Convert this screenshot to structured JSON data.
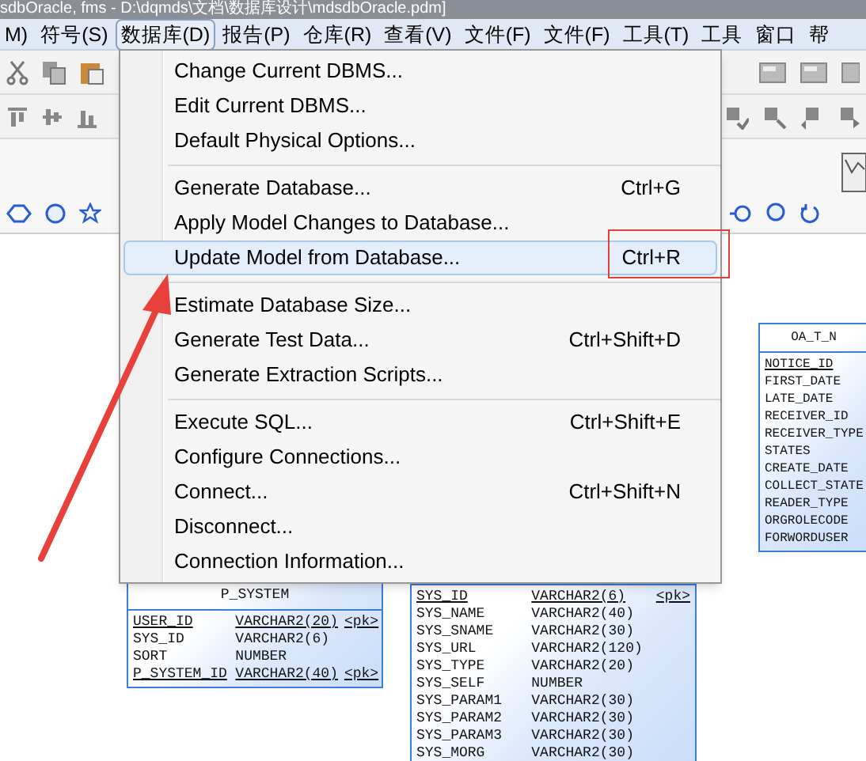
{
  "window": {
    "title": "sdbOracle, fms - D:\\dqmds\\文档\\数据库设计\\mdsdbOracle.pdm]"
  },
  "menu_bar": [
    {
      "label": "M)",
      "selected": false
    },
    {
      "label": "符号(S)",
      "selected": false
    },
    {
      "label": "数据库(D)",
      "selected": true
    },
    {
      "label": "报告(P)",
      "selected": false
    },
    {
      "label": "仓库(R)",
      "selected": false
    },
    {
      "label": "查看(V)",
      "selected": false
    },
    {
      "label": "文件(F)",
      "selected": false
    },
    {
      "label": "文件(F)",
      "selected": false
    },
    {
      "label": "工具(T)",
      "selected": false
    },
    {
      "label": "工具",
      "selected": false
    },
    {
      "label": "窗口",
      "selected": false
    },
    {
      "label": "帮",
      "selected": false
    }
  ],
  "dropdown": {
    "groups": [
      [
        {
          "label": "Change Current DBMS...",
          "selected": false
        },
        {
          "label": "Edit Current DBMS...",
          "selected": false
        },
        {
          "label": "Default Physical Options...",
          "selected": false
        }
      ],
      [
        {
          "label": "Generate Database...",
          "shortcut": "Ctrl+G",
          "selected": false
        },
        {
          "label": "Apply Model Changes to Database...",
          "selected": false
        },
        {
          "label": "Update Model from Database...",
          "shortcut": "Ctrl+R",
          "selected": true
        }
      ],
      [
        {
          "label": "Estimate Database Size...",
          "selected": false
        },
        {
          "label": "Generate Test Data...",
          "shortcut": "Ctrl+Shift+D",
          "selected": false
        },
        {
          "label": "Generate Extraction Scripts...",
          "selected": false
        }
      ],
      [
        {
          "label": "Execute SQL...",
          "shortcut": "Ctrl+Shift+E",
          "selected": false
        },
        {
          "label": "Configure Connections...",
          "selected": false
        },
        {
          "label": "Connect...",
          "shortcut": "Ctrl+Shift+N",
          "selected": false
        },
        {
          "label": "Disconnect...",
          "selected": false
        },
        {
          "label": "Connection Information...",
          "selected": false
        }
      ]
    ]
  },
  "diagram": {
    "tables": [
      {
        "name": "P_SYSTEM",
        "columns": [
          {
            "name": "USER_ID",
            "type": "VARCHAR2(20)",
            "key": "<pk>"
          },
          {
            "name": "SYS_ID",
            "type": "VARCHAR2(6)"
          },
          {
            "name": "SORT",
            "type": "NUMBER"
          },
          {
            "name": "P_SYSTEM_ID",
            "type": "VARCHAR2(40)",
            "key": "<pk>"
          }
        ]
      },
      {
        "columns": [
          {
            "name": "SYS_ID",
            "type": "VARCHAR2(6)",
            "key": "<pk>"
          },
          {
            "name": "SYS_NAME",
            "type": "VARCHAR2(40)"
          },
          {
            "name": "SYS_SNAME",
            "type": "VARCHAR2(30)"
          },
          {
            "name": "SYS_URL",
            "type": "VARCHAR2(120)"
          },
          {
            "name": "SYS_TYPE",
            "type": "VARCHAR2(20)"
          },
          {
            "name": "SYS_SELF",
            "type": "NUMBER"
          },
          {
            "name": "SYS_PARAM1",
            "type": "VARCHAR2(30)"
          },
          {
            "name": "SYS_PARAM2",
            "type": "VARCHAR2(30)"
          },
          {
            "name": "SYS_PARAM3",
            "type": "VARCHAR2(30)"
          },
          {
            "name": "SYS_MORG",
            "type": "VARCHAR2(30)"
          }
        ]
      },
      {
        "name": "OA_T_N",
        "columns": [
          {
            "name": "NOTICE_ID",
            "key_column": true
          },
          {
            "name": "FIRST_DATE"
          },
          {
            "name": "LATE_DATE"
          },
          {
            "name": "RECEIVER_ID"
          },
          {
            "name": "RECEIVER_TYPE"
          },
          {
            "name": "STATES"
          },
          {
            "name": "CREATE_DATE"
          },
          {
            "name": "COLLECT_STATE"
          },
          {
            "name": "READER_TYPE"
          },
          {
            "name": "ORGROLECODE"
          },
          {
            "name": "FORWORDUSER"
          }
        ]
      }
    ]
  }
}
